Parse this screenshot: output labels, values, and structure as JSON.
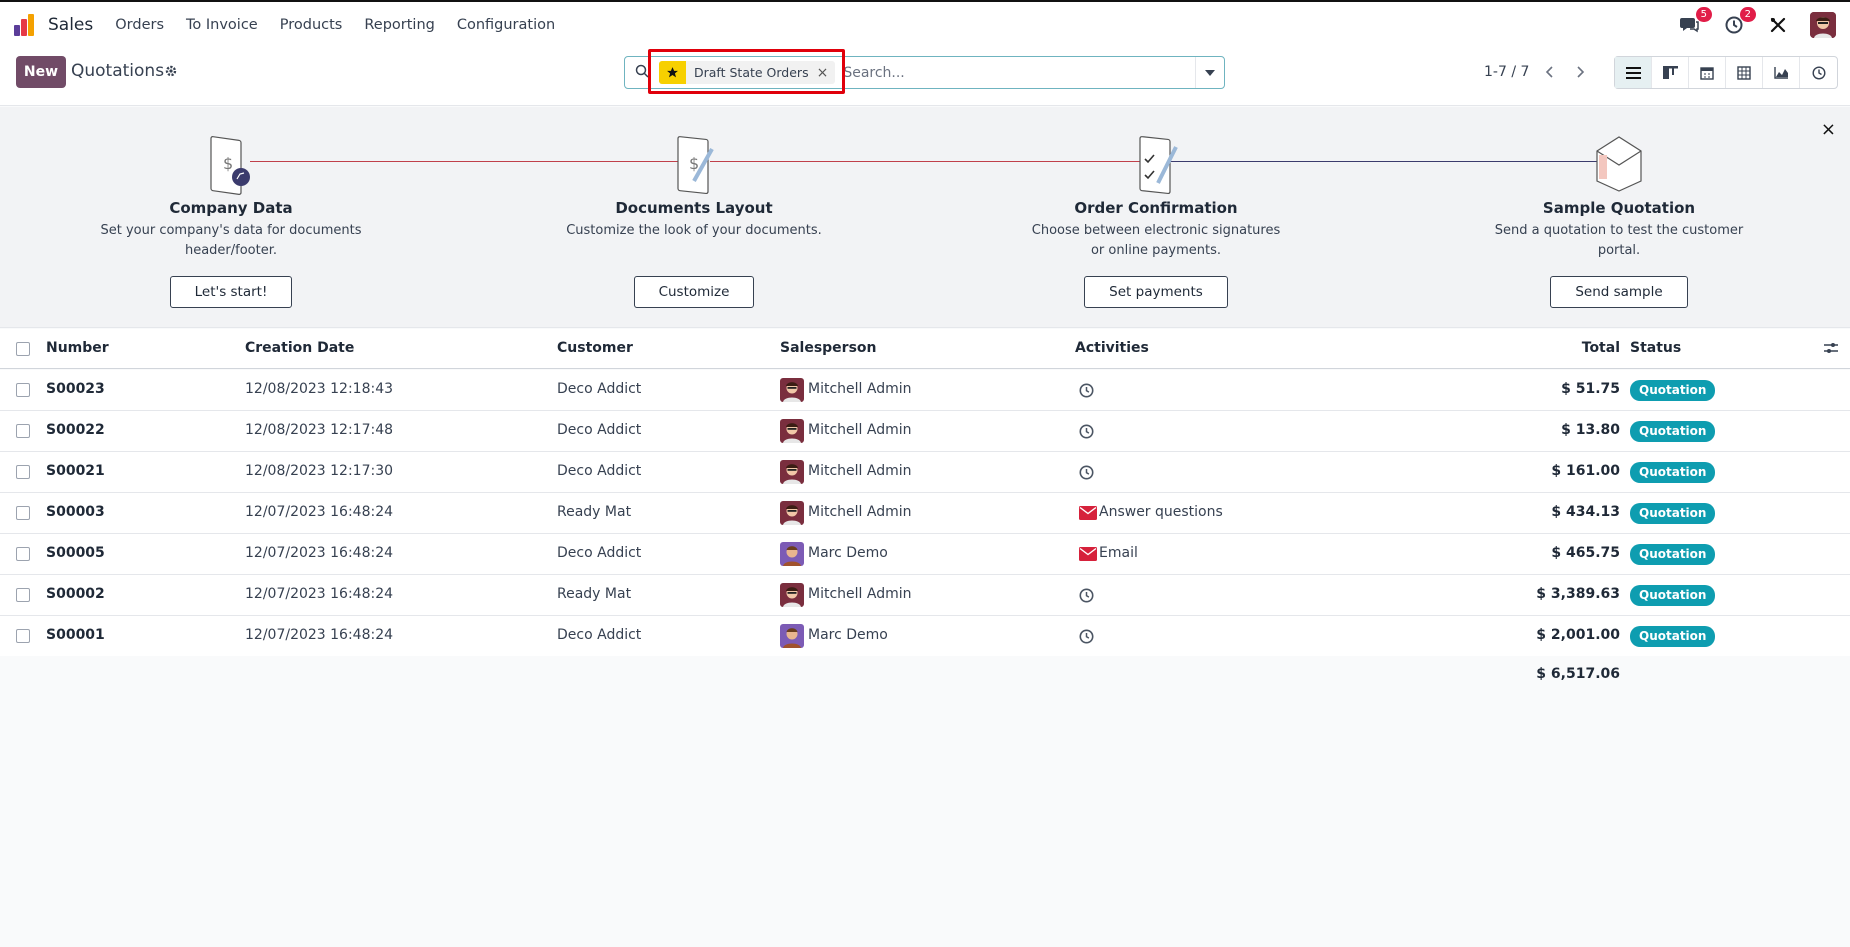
{
  "topbar": {
    "app_name": "Sales",
    "menu": [
      "Orders",
      "To Invoice",
      "Products",
      "Reporting",
      "Configuration"
    ],
    "messages_count": "5",
    "activities_count": "2"
  },
  "control": {
    "new_label": "New",
    "title": "Quotations",
    "facet_label": "Draft State Orders",
    "facet_remove": "×",
    "search_placeholder": "Search...",
    "pager": "1-7 / 7"
  },
  "onboarding": {
    "close": "×",
    "steps": [
      {
        "title": "Company Data",
        "desc1": "Set your company's data for documents",
        "desc2": "header/footer.",
        "button": "Let's start!"
      },
      {
        "title": "Documents Layout",
        "desc1": "Customize the look of your documents.",
        "desc2": "",
        "button": "Customize"
      },
      {
        "title": "Order Confirmation",
        "desc1": "Choose between electronic signatures",
        "desc2": "or online payments.",
        "button": "Set payments"
      },
      {
        "title": "Sample Quotation",
        "desc1": "Send a quotation to test the customer",
        "desc2": "portal.",
        "button": "Send sample"
      }
    ]
  },
  "table": {
    "columns": [
      "Number",
      "Creation Date",
      "Customer",
      "Salesperson",
      "Activities",
      "Total",
      "Status"
    ],
    "rows": [
      {
        "number": "S00023",
        "date": "12/08/2023 12:18:43",
        "customer": "Deco Addict",
        "salesperson": "Mitchell Admin",
        "activity": "",
        "activity_icon": "clock-icon",
        "total": "$ 51.75",
        "status": "Quotation"
      },
      {
        "number": "S00022",
        "date": "12/08/2023 12:17:48",
        "customer": "Deco Addict",
        "salesperson": "Mitchell Admin",
        "activity": "",
        "activity_icon": "clock-icon",
        "total": "$ 13.80",
        "status": "Quotation"
      },
      {
        "number": "S00021",
        "date": "12/08/2023 12:17:30",
        "customer": "Deco Addict",
        "salesperson": "Mitchell Admin",
        "activity": "",
        "activity_icon": "clock-icon",
        "total": "$ 161.00",
        "status": "Quotation"
      },
      {
        "number": "S00003",
        "date": "12/07/2023 16:48:24",
        "customer": "Ready Mat",
        "salesperson": "Mitchell Admin",
        "activity": "Answer questions",
        "activity_icon": "envelope-icon",
        "total": "$ 434.13",
        "status": "Quotation"
      },
      {
        "number": "S00005",
        "date": "12/07/2023 16:48:24",
        "customer": "Deco Addict",
        "salesperson": "Marc Demo",
        "activity": "Email",
        "activity_icon": "envelope-icon",
        "total": "$ 465.75",
        "status": "Quotation"
      },
      {
        "number": "S00002",
        "date": "12/07/2023 16:48:24",
        "customer": "Ready Mat",
        "salesperson": "Mitchell Admin",
        "activity": "",
        "activity_icon": "clock-icon",
        "total": "$ 3,389.63",
        "status": "Quotation"
      },
      {
        "number": "S00001",
        "date": "12/07/2023 16:48:24",
        "customer": "Deco Addict",
        "salesperson": "Marc Demo",
        "activity": "",
        "activity_icon": "clock-icon",
        "total": "$ 2,001.00",
        "status": "Quotation"
      }
    ],
    "grand_total": "$ 6,517.06"
  },
  "colors": {
    "brand": "#714b67",
    "status": "#0e9db0",
    "highlight": "#e0000b",
    "facet_star": "#f7d000"
  }
}
